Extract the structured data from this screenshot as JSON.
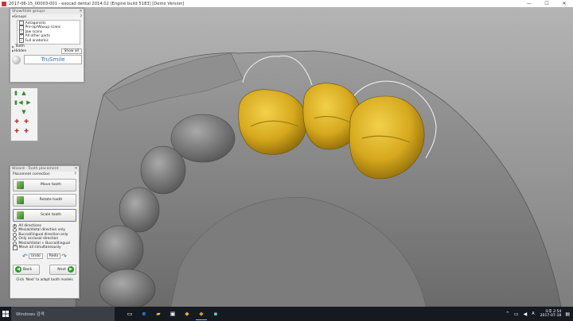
{
  "window": {
    "title": "2017-06-15_00003-001 - exocad dental 2014.02 [Engine build 5183] [Demo Version]",
    "minimize": "—",
    "maximize": "☐",
    "close": "✕"
  },
  "show_hide": {
    "header": "Show/Hide groups",
    "close": "✕",
    "groups_label": "Groups",
    "help": "?",
    "items": [
      {
        "label": "Antagonists",
        "checked": false
      },
      {
        "label": "Pre-op/Waxup scans",
        "checked": false
      },
      {
        "label": "Jaw scans",
        "checked": true
      },
      {
        "label": "All other parts",
        "checked": true
      },
      {
        "label": "Full anatomic",
        "checked": true
      }
    ],
    "teeth_label": "Teeth",
    "hidden_label": "Hidden",
    "show_all": "Show all",
    "trusmile": "TruSmile"
  },
  "wizard": {
    "header": "Wizard - Tooth placement",
    "close": "✕",
    "section": "Placement correction",
    "help": "?",
    "buttons": {
      "move": "Move tooth",
      "rotate": "Rotate tooth",
      "scale": "Scale tooth"
    },
    "options": [
      {
        "label": "All directions",
        "on": true
      },
      {
        "label": "Mesial/distal direction only",
        "on": false
      },
      {
        "label": "Buccal/lingual direction only",
        "on": false
      },
      {
        "label": "Only occlusal direction",
        "on": false
      },
      {
        "label": "Mesial/distal + Buccal/lingual",
        "on": false
      }
    ],
    "move_all": "Move all simultaneously",
    "undo": "Undo",
    "redo": "Redo",
    "back": "Back",
    "next": "Next",
    "hint": "Click 'Next' to adapt tooth models"
  },
  "taskbar": {
    "search_placeholder": "Windows 검색",
    "time": "오후 2:54",
    "date": "2017-07-18"
  },
  "colors": {
    "tooth": "#d6a81e",
    "jaw": "#8a8a8a",
    "accent": "#1e6fbf"
  }
}
